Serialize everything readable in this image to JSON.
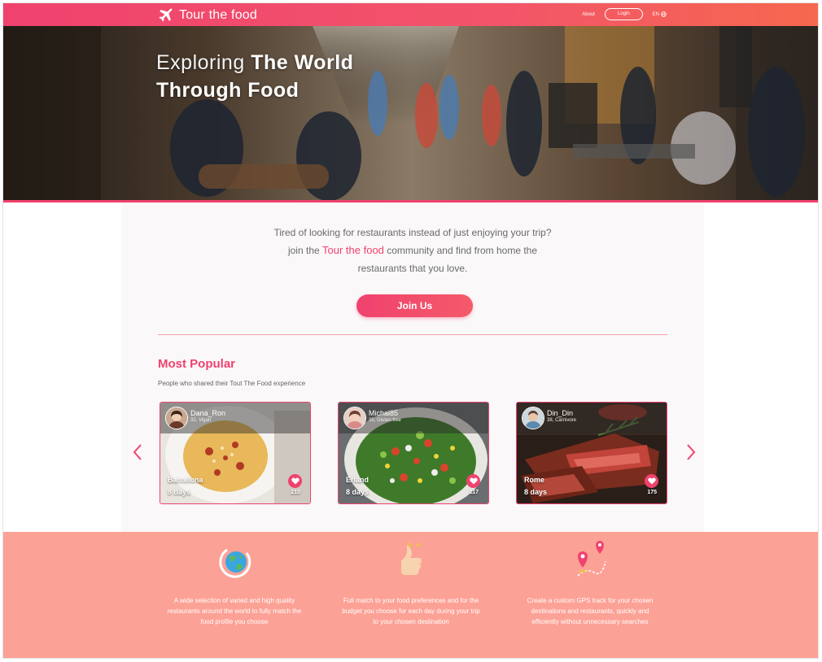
{
  "header": {
    "brand": "Tour the food",
    "nav_about": "About",
    "nav_login": "Login",
    "nav_lang": "EN"
  },
  "hero": {
    "title_thin": "Exploring",
    "title_bold_1": "The World",
    "title_bold_2": "Through Food"
  },
  "intro": {
    "line1": "Tired of looking for restaurants instead of just enjoying  your trip?",
    "line2_pre": "join the",
    "line2_brand": "Tour the food",
    "line2_post": "community and find from home the",
    "line3": "restaurants that you love."
  },
  "join_button": "Join Us",
  "popular": {
    "title": "Most Popular",
    "subtitle": "People who shared their Tout The Food experience",
    "cards": [
      {
        "user": "Dana_Ron",
        "info": "32, Vigan",
        "city": "Barcelona",
        "days": "8 days",
        "likes": "210"
      },
      {
        "user": "Michal85",
        "info": "35, Gluten free",
        "city": "Erland",
        "days": "8 days",
        "likes": "117"
      },
      {
        "user": "Din_Din",
        "info": "38, Carnivore",
        "city": "Rome",
        "days": "8 days",
        "likes": "175"
      }
    ]
  },
  "features": [
    {
      "icon": "globe-icon",
      "text": "A wide selection of varied and high quality restaurants around the world to fully match the food profile you choose"
    },
    {
      "icon": "thumbs-up-icon",
      "text": "Full match to your food preferences and for the budget you choose for each day during your trip to your chosen destination"
    },
    {
      "icon": "gps-route-icon",
      "text": "Create a custom GPS track for your chosen destinations and restaurants, quickly and efficiently without unnecessary searches"
    }
  ],
  "colors": {
    "accent": "#f0426e",
    "footer": "#fca196"
  }
}
